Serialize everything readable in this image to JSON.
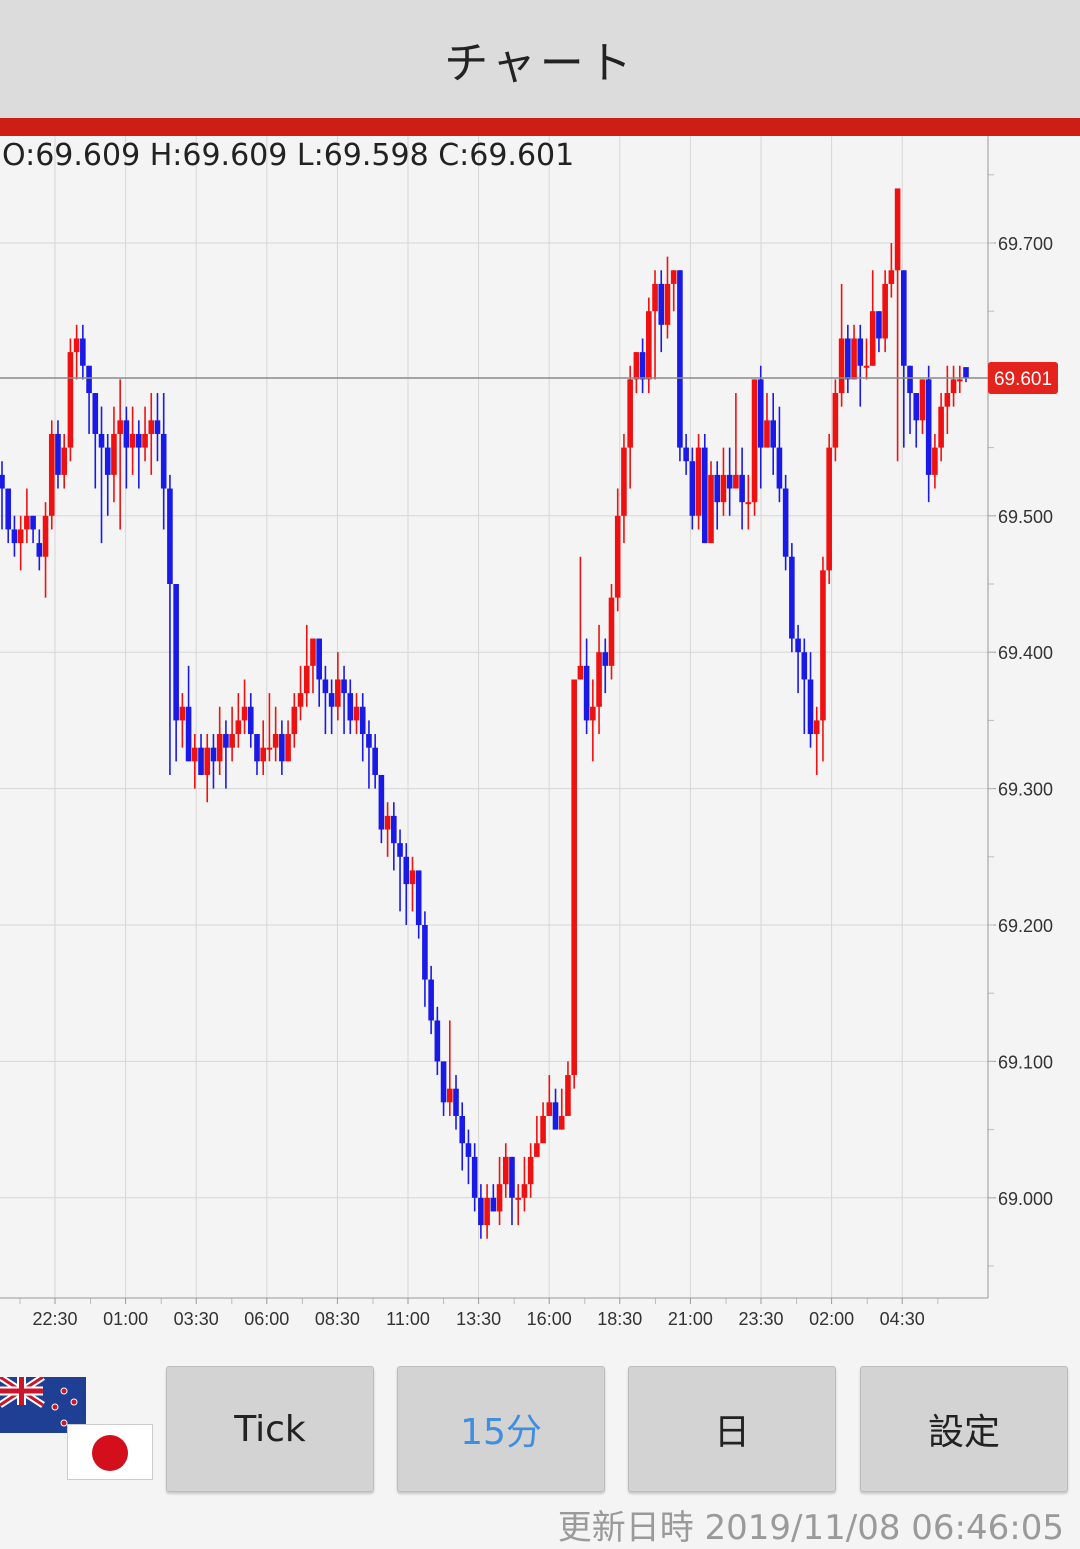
{
  "header": {
    "title": "チャート"
  },
  "ohlc": "O:69.609 H:69.609 L:69.598 C:69.601",
  "current_price": "69.601",
  "chart_data": {
    "type": "candlestick",
    "x_ticks": [
      "22:30",
      "01:00",
      "03:30",
      "06:00",
      "08:30",
      "11:00",
      "13:30",
      "16:00",
      "18:30",
      "21:00",
      "23:30",
      "02:00",
      "04:30"
    ],
    "y_ticks": [
      "69.700",
      "69.500",
      "69.400",
      "69.300",
      "69.200",
      "69.100",
      "69.000"
    ],
    "ylim": [
      68.95,
      69.72
    ],
    "grid": true,
    "up_color": "#ee1111",
    "down_color": "#1a1ae6",
    "candles": [
      [
        69.53,
        69.52,
        69.54,
        69.49
      ],
      [
        69.52,
        69.49,
        69.52,
        69.48
      ],
      [
        69.49,
        69.48,
        69.5,
        69.47
      ],
      [
        69.48,
        69.49,
        69.5,
        69.46
      ],
      [
        69.49,
        69.5,
        69.52,
        69.48
      ],
      [
        69.5,
        69.49,
        69.5,
        69.48
      ],
      [
        69.48,
        69.47,
        69.49,
        69.46
      ],
      [
        69.47,
        69.5,
        69.51,
        69.44
      ],
      [
        69.5,
        69.56,
        69.57,
        69.49
      ],
      [
        69.56,
        69.53,
        69.57,
        69.52
      ],
      [
        69.53,
        69.55,
        69.56,
        69.52
      ],
      [
        69.55,
        69.62,
        69.63,
        69.54
      ],
      [
        69.62,
        69.63,
        69.64,
        69.6
      ],
      [
        69.63,
        69.61,
        69.64,
        69.6
      ],
      [
        69.61,
        69.59,
        69.61,
        69.56
      ],
      [
        69.59,
        69.56,
        69.59,
        69.52
      ],
      [
        69.56,
        69.55,
        69.58,
        69.48
      ],
      [
        69.55,
        69.53,
        69.56,
        69.5
      ],
      [
        69.53,
        69.56,
        69.58,
        69.51
      ],
      [
        69.56,
        69.57,
        69.6,
        69.49
      ],
      [
        69.57,
        69.55,
        69.58,
        69.52
      ],
      [
        69.55,
        69.56,
        69.58,
        69.53
      ],
      [
        69.56,
        69.55,
        69.57,
        69.52
      ],
      [
        69.55,
        69.56,
        69.58,
        69.54
      ],
      [
        69.56,
        69.57,
        69.59,
        69.53
      ],
      [
        69.57,
        69.56,
        69.59,
        69.54
      ],
      [
        69.56,
        69.52,
        69.59,
        69.49
      ],
      [
        69.52,
        69.45,
        69.53,
        69.31
      ],
      [
        69.45,
        69.35,
        69.45,
        69.32
      ],
      [
        69.35,
        69.36,
        69.37,
        69.33
      ],
      [
        69.36,
        69.32,
        69.39,
        69.32
      ],
      [
        69.32,
        69.33,
        69.34,
        69.3
      ],
      [
        69.33,
        69.31,
        69.34,
        69.31
      ],
      [
        69.31,
        69.33,
        69.34,
        69.29
      ],
      [
        69.33,
        69.32,
        69.34,
        69.3
      ],
      [
        69.32,
        69.34,
        69.36,
        69.31
      ],
      [
        69.34,
        69.33,
        69.35,
        69.3
      ],
      [
        69.33,
        69.34,
        69.36,
        69.32
      ],
      [
        69.34,
        69.35,
        69.37,
        69.33
      ],
      [
        69.35,
        69.36,
        69.38,
        69.34
      ],
      [
        69.36,
        69.34,
        69.37,
        69.33
      ],
      [
        69.34,
        69.32,
        69.34,
        69.31
      ],
      [
        69.32,
        69.33,
        69.35,
        69.31
      ],
      [
        69.33,
        69.33,
        69.37,
        69.32
      ],
      [
        69.33,
        69.34,
        69.36,
        69.32
      ],
      [
        69.34,
        69.32,
        69.35,
        69.31
      ],
      [
        69.32,
        69.34,
        69.35,
        69.32
      ],
      [
        69.34,
        69.36,
        69.37,
        69.33
      ],
      [
        69.36,
        69.37,
        69.39,
        69.35
      ],
      [
        69.37,
        69.39,
        69.42,
        69.36
      ],
      [
        69.39,
        69.41,
        69.41,
        69.37
      ],
      [
        69.41,
        69.38,
        69.41,
        69.36
      ],
      [
        69.38,
        69.37,
        69.39,
        69.34
      ],
      [
        69.37,
        69.36,
        69.38,
        69.34
      ],
      [
        69.36,
        69.38,
        69.4,
        69.35
      ],
      [
        69.38,
        69.37,
        69.39,
        69.34
      ],
      [
        69.37,
        69.35,
        69.38,
        69.34
      ],
      [
        69.35,
        69.36,
        69.37,
        69.34
      ],
      [
        69.36,
        69.34,
        69.37,
        69.32
      ],
      [
        69.34,
        69.33,
        69.35,
        69.3
      ],
      [
        69.33,
        69.31,
        69.34,
        69.3
      ],
      [
        69.31,
        69.27,
        69.31,
        69.26
      ],
      [
        69.27,
        69.28,
        69.29,
        69.25
      ],
      [
        69.28,
        69.26,
        69.29,
        69.24
      ],
      [
        69.26,
        69.25,
        69.27,
        69.21
      ],
      [
        69.25,
        69.23,
        69.26,
        69.2
      ],
      [
        69.23,
        69.24,
        69.25,
        69.21
      ],
      [
        69.24,
        69.2,
        69.24,
        69.19
      ],
      [
        69.2,
        69.16,
        69.21,
        69.14
      ],
      [
        69.16,
        69.13,
        69.17,
        69.12
      ],
      [
        69.13,
        69.1,
        69.14,
        69.09
      ],
      [
        69.1,
        69.07,
        69.1,
        69.06
      ],
      [
        69.07,
        69.08,
        69.13,
        69.06
      ],
      [
        69.08,
        69.06,
        69.09,
        69.05
      ],
      [
        69.06,
        69.04,
        69.07,
        69.02
      ],
      [
        69.04,
        69.03,
        69.05,
        69.01
      ],
      [
        69.03,
        69.0,
        69.04,
        68.99
      ],
      [
        69.0,
        68.98,
        69.01,
        68.97
      ],
      [
        68.98,
        69.0,
        69.01,
        68.97
      ],
      [
        69.0,
        68.99,
        69.01,
        68.99
      ],
      [
        68.99,
        69.01,
        69.03,
        68.98
      ],
      [
        69.01,
        69.03,
        69.04,
        69.0
      ],
      [
        69.03,
        69.0,
        69.03,
        68.98
      ],
      [
        69.0,
        69.0,
        69.01,
        68.98
      ],
      [
        69.0,
        69.01,
        69.03,
        68.99
      ],
      [
        69.01,
        69.03,
        69.04,
        69.0
      ],
      [
        69.03,
        69.04,
        69.06,
        69.03
      ],
      [
        69.04,
        69.06,
        69.07,
        69.05
      ],
      [
        69.06,
        69.07,
        69.09,
        69.06
      ],
      [
        69.07,
        69.05,
        69.08,
        69.05
      ],
      [
        69.05,
        69.06,
        69.08,
        69.05
      ],
      [
        69.06,
        69.09,
        69.1,
        69.07
      ],
      [
        69.09,
        69.38,
        69.38,
        69.08
      ],
      [
        69.38,
        69.39,
        69.47,
        69.38
      ],
      [
        69.39,
        69.35,
        69.41,
        69.34
      ],
      [
        69.35,
        69.36,
        69.38,
        69.32
      ],
      [
        69.36,
        69.4,
        69.42,
        69.34
      ],
      [
        69.4,
        69.39,
        69.41,
        69.37
      ],
      [
        69.39,
        69.44,
        69.45,
        69.38
      ],
      [
        69.44,
        69.5,
        69.52,
        69.43
      ],
      [
        69.5,
        69.55,
        69.56,
        69.48
      ],
      [
        69.55,
        69.6,
        69.61,
        69.52
      ],
      [
        69.6,
        69.62,
        69.62,
        69.59
      ],
      [
        69.62,
        69.6,
        69.63,
        69.59
      ],
      [
        69.6,
        69.65,
        69.66,
        69.59
      ],
      [
        69.65,
        69.67,
        69.68,
        69.6
      ],
      [
        69.67,
        69.64,
        69.68,
        69.62
      ],
      [
        69.64,
        69.67,
        69.69,
        69.63
      ],
      [
        69.67,
        69.68,
        69.68,
        69.65
      ],
      [
        69.68,
        69.55,
        69.68,
        69.54
      ],
      [
        69.55,
        69.54,
        69.56,
        69.53
      ],
      [
        69.54,
        69.5,
        69.55,
        69.49
      ],
      [
        69.5,
        69.55,
        69.56,
        69.49
      ],
      [
        69.55,
        69.48,
        69.56,
        69.48
      ],
      [
        69.48,
        69.53,
        69.54,
        69.48
      ],
      [
        69.53,
        69.51,
        69.54,
        69.49
      ],
      [
        69.51,
        69.53,
        69.55,
        69.5
      ],
      [
        69.53,
        69.52,
        69.55,
        69.5
      ],
      [
        69.52,
        69.53,
        69.59,
        69.52
      ],
      [
        69.53,
        69.51,
        69.55,
        69.49
      ],
      [
        69.51,
        69.51,
        69.53,
        69.49
      ],
      [
        69.51,
        69.6,
        69.6,
        69.5
      ],
      [
        69.6,
        69.55,
        69.61,
        69.52
      ],
      [
        69.55,
        69.57,
        69.59,
        69.55
      ],
      [
        69.57,
        69.55,
        69.59,
        69.53
      ],
      [
        69.55,
        69.52,
        69.58,
        69.51
      ],
      [
        69.52,
        69.47,
        69.53,
        69.46
      ],
      [
        69.47,
        69.41,
        69.48,
        69.4
      ],
      [
        69.41,
        69.4,
        69.42,
        69.37
      ],
      [
        69.4,
        69.38,
        69.41,
        69.34
      ],
      [
        69.38,
        69.34,
        69.4,
        69.33
      ],
      [
        69.34,
        69.35,
        69.36,
        69.31
      ],
      [
        69.35,
        69.46,
        69.47,
        69.32
      ],
      [
        69.46,
        69.55,
        69.56,
        69.45
      ],
      [
        69.55,
        69.59,
        69.6,
        69.54
      ],
      [
        69.59,
        69.63,
        69.67,
        69.58
      ],
      [
        69.63,
        69.6,
        69.64,
        69.59
      ],
      [
        69.6,
        69.63,
        69.64,
        69.6
      ],
      [
        69.63,
        69.61,
        69.64,
        69.58
      ],
      [
        69.61,
        69.61,
        69.63,
        69.6
      ],
      [
        69.61,
        69.65,
        69.68,
        69.61
      ],
      [
        69.65,
        69.63,
        69.65,
        69.62
      ],
      [
        69.63,
        69.67,
        69.68,
        69.62
      ],
      [
        69.67,
        69.68,
        69.7,
        69.66
      ],
      [
        69.68,
        69.74,
        69.74,
        69.54
      ],
      [
        69.68,
        69.61,
        69.68,
        69.55
      ],
      [
        69.61,
        69.59,
        69.61,
        69.56
      ],
      [
        69.59,
        69.57,
        69.59,
        69.55
      ],
      [
        69.57,
        69.6,
        69.6,
        69.56
      ],
      [
        69.6,
        69.53,
        69.61,
        69.51
      ],
      [
        69.53,
        69.55,
        69.56,
        69.52
      ],
      [
        69.55,
        69.58,
        69.59,
        69.54
      ],
      [
        69.58,
        69.59,
        69.61,
        69.56
      ],
      [
        69.59,
        69.6,
        69.61,
        69.58
      ],
      [
        69.6,
        69.6,
        69.61,
        69.59
      ],
      [
        69.609,
        69.601,
        69.609,
        69.598
      ]
    ]
  },
  "tabs": [
    {
      "label": "Tick",
      "active": false
    },
    {
      "label": "15分",
      "active": true
    },
    {
      "label": "日",
      "active": false
    },
    {
      "label": "設定",
      "active": false
    }
  ],
  "updated": "更新日時 2019/11/08 06:46:05",
  "flags": [
    "new-zealand-flag",
    "japan-flag"
  ]
}
